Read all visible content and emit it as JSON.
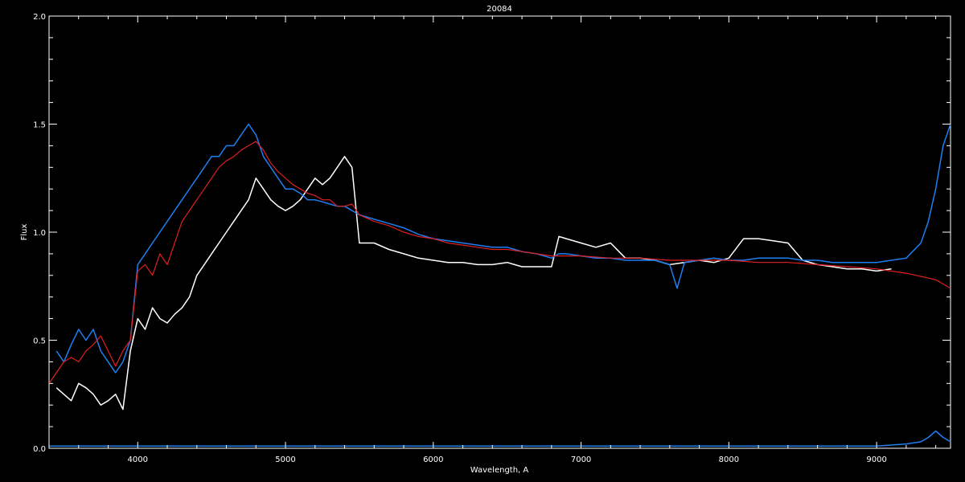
{
  "chart_data": {
    "type": "line",
    "title": "20084",
    "xlabel": "Wavelength, A",
    "ylabel": "Flux",
    "xlim": [
      3400,
      9500
    ],
    "ylim": [
      0,
      2
    ],
    "x_ticks": [
      4000,
      5000,
      6000,
      7000,
      8000,
      9000
    ],
    "x_tick_labels": [
      "4000",
      "5000",
      "6000",
      "7000",
      "8000",
      "9000"
    ],
    "y_ticks": [
      0,
      0.5,
      1,
      1.5,
      2
    ],
    "y_tick_labels": [
      "0.0",
      "0.5",
      "1.0",
      "1.5",
      "2.0"
    ],
    "grid": false,
    "background": "#000000",
    "series": [
      {
        "color": "#ffffff",
        "x": [
          3450,
          3500,
          3550,
          3600,
          3650,
          3700,
          3750,
          3800,
          3850,
          3900,
          3950,
          4000,
          4050,
          4100,
          4150,
          4200,
          4250,
          4300,
          4350,
          4400,
          4450,
          4500,
          4550,
          4600,
          4650,
          4700,
          4750,
          4800,
          4850,
          4900,
          4950,
          5000,
          5050,
          5100,
          5150,
          5200,
          5250,
          5300,
          5350,
          5400,
          5450,
          5500,
          5600,
          5700,
          5800,
          5900,
          6000,
          6100,
          6200,
          6300,
          6400,
          6500,
          6600,
          6700,
          6800,
          6850,
          6900,
          7000,
          7100,
          7200,
          7300,
          7400,
          7500,
          7600,
          7700,
          7800,
          7900,
          8000,
          8100,
          8200,
          8300,
          8400,
          8500,
          8600,
          8700,
          8800,
          8900,
          9000,
          9100
        ],
        "values": [
          0.28,
          0.25,
          0.22,
          0.3,
          0.28,
          0.25,
          0.2,
          0.22,
          0.25,
          0.18,
          0.45,
          0.6,
          0.55,
          0.65,
          0.6,
          0.58,
          0.62,
          0.65,
          0.7,
          0.8,
          0.85,
          0.9,
          0.95,
          1.0,
          1.05,
          1.1,
          1.15,
          1.25,
          1.2,
          1.15,
          1.12,
          1.1,
          1.12,
          1.15,
          1.2,
          1.25,
          1.22,
          1.25,
          1.3,
          1.35,
          1.3,
          0.95,
          0.95,
          0.92,
          0.9,
          0.88,
          0.87,
          0.86,
          0.86,
          0.85,
          0.85,
          0.86,
          0.84,
          0.84,
          0.84,
          0.98,
          0.97,
          0.95,
          0.93,
          0.95,
          0.88,
          0.88,
          0.87,
          0.85,
          0.86,
          0.87,
          0.86,
          0.88,
          0.97,
          0.97,
          0.96,
          0.95,
          0.87,
          0.85,
          0.84,
          0.83,
          0.83,
          0.82,
          0.83
        ]
      },
      {
        "color": "#1e7ff0",
        "x": [
          3450,
          3500,
          3550,
          3600,
          3650,
          3700,
          3750,
          3800,
          3850,
          3900,
          3950,
          4000,
          4050,
          4100,
          4150,
          4200,
          4250,
          4300,
          4350,
          4400,
          4450,
          4500,
          4550,
          4600,
          4650,
          4700,
          4750,
          4800,
          4850,
          4900,
          4950,
          5000,
          5050,
          5100,
          5150,
          5200,
          5250,
          5300,
          5350,
          5400,
          5450,
          5500,
          5600,
          5700,
          5800,
          5900,
          6000,
          6100,
          6200,
          6300,
          6400,
          6500,
          6600,
          6700,
          6800,
          6850,
          6900,
          7000,
          7100,
          7200,
          7300,
          7400,
          7500,
          7600,
          7650,
          7700,
          7800,
          7900,
          8000,
          8100,
          8200,
          8300,
          8400,
          8500,
          8600,
          8700,
          8800,
          8900,
          9000,
          9100,
          9200,
          9300,
          9350,
          9400,
          9450,
          9500
        ],
        "values": [
          0.45,
          0.4,
          0.48,
          0.55,
          0.5,
          0.55,
          0.45,
          0.4,
          0.35,
          0.4,
          0.5,
          0.85,
          0.9,
          0.95,
          1.0,
          1.05,
          1.1,
          1.15,
          1.2,
          1.25,
          1.3,
          1.35,
          1.35,
          1.4,
          1.4,
          1.45,
          1.5,
          1.45,
          1.35,
          1.3,
          1.25,
          1.2,
          1.2,
          1.18,
          1.15,
          1.15,
          1.14,
          1.13,
          1.12,
          1.12,
          1.1,
          1.08,
          1.06,
          1.04,
          1.02,
          0.99,
          0.97,
          0.96,
          0.95,
          0.94,
          0.93,
          0.93,
          0.91,
          0.9,
          0.88,
          0.9,
          0.9,
          0.89,
          0.88,
          0.88,
          0.87,
          0.87,
          0.87,
          0.85,
          0.74,
          0.86,
          0.87,
          0.88,
          0.87,
          0.87,
          0.88,
          0.88,
          0.88,
          0.87,
          0.87,
          0.86,
          0.86,
          0.86,
          0.86,
          0.87,
          0.88,
          0.95,
          1.05,
          1.2,
          1.4,
          1.5
        ]
      },
      {
        "color": "#e02020",
        "x": [
          3400,
          3450,
          3500,
          3550,
          3600,
          3650,
          3700,
          3750,
          3800,
          3850,
          3900,
          3950,
          4000,
          4050,
          4100,
          4150,
          4200,
          4250,
          4300,
          4350,
          4400,
          4450,
          4500,
          4550,
          4600,
          4650,
          4700,
          4750,
          4800,
          4850,
          4900,
          4950,
          5000,
          5050,
          5100,
          5150,
          5200,
          5250,
          5300,
          5350,
          5400,
          5450,
          5500,
          5600,
          5700,
          5800,
          5900,
          6000,
          6100,
          6200,
          6300,
          6400,
          6500,
          6600,
          6700,
          6800,
          7000,
          7200,
          7400,
          7600,
          7800,
          8000,
          8200,
          8400,
          8600,
          8800,
          9000,
          9200,
          9400,
          9500
        ],
        "values": [
          0.3,
          0.35,
          0.4,
          0.42,
          0.4,
          0.45,
          0.48,
          0.52,
          0.45,
          0.38,
          0.45,
          0.5,
          0.82,
          0.85,
          0.8,
          0.9,
          0.85,
          0.95,
          1.05,
          1.1,
          1.15,
          1.2,
          1.25,
          1.3,
          1.33,
          1.35,
          1.38,
          1.4,
          1.42,
          1.38,
          1.32,
          1.28,
          1.25,
          1.22,
          1.2,
          1.18,
          1.17,
          1.15,
          1.15,
          1.12,
          1.12,
          1.13,
          1.08,
          1.05,
          1.03,
          1.0,
          0.98,
          0.97,
          0.95,
          0.94,
          0.93,
          0.92,
          0.92,
          0.91,
          0.9,
          0.89,
          0.89,
          0.88,
          0.88,
          0.87,
          0.87,
          0.87,
          0.86,
          0.86,
          0.85,
          0.84,
          0.83,
          0.81,
          0.78,
          0.74
        ]
      },
      {
        "color": "#1e7ff0",
        "x": [
          3400,
          4000,
          5000,
          6000,
          7000,
          8000,
          9000,
          9200,
          9300,
          9350,
          9400,
          9450,
          9500
        ],
        "values": [
          0.01,
          0.01,
          0.01,
          0.01,
          0.01,
          0.01,
          0.01,
          0.02,
          0.03,
          0.05,
          0.08,
          0.05,
          0.03
        ]
      }
    ]
  }
}
